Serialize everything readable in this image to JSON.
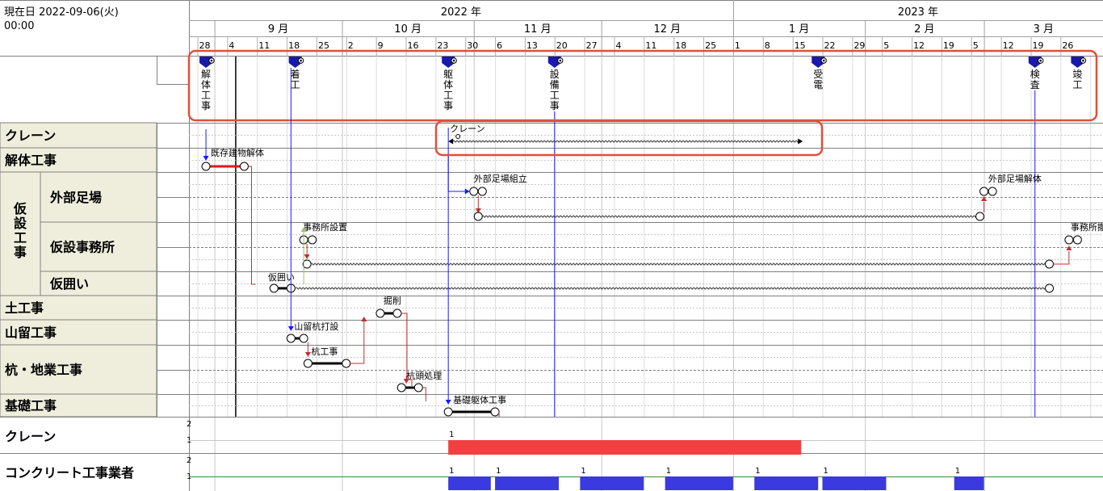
{
  "header": {
    "current_date_label": "現在日 2022-09-06(火)",
    "current_time": "00:00"
  },
  "timeline": {
    "years": [
      "2022 年",
      "2023 年"
    ],
    "months": [
      "9 月",
      "10 月",
      "11 月",
      "12 月",
      "1 月",
      "2 月",
      "3 月"
    ],
    "weeks": [
      "28",
      "4",
      "11",
      "18",
      "25",
      "2",
      "9",
      "16",
      "23",
      "30",
      "6",
      "13",
      "20",
      "27",
      "4",
      "11",
      "18",
      "25",
      "1",
      "8",
      "15",
      "22",
      "29",
      "5",
      "12",
      "19",
      "5",
      "12",
      "19",
      "26"
    ]
  },
  "milestones": [
    {
      "label": "解体工事",
      "date": "2022-08-30"
    },
    {
      "label": "着工",
      "date": "2022-09-20"
    },
    {
      "label": "躯体工事",
      "date": "2022-10-26"
    },
    {
      "label": "設備工事",
      "date": "2022-11-20"
    },
    {
      "label": "受電",
      "date": "2023-01-21"
    },
    {
      "label": "検査",
      "date": "2023-03-13"
    },
    {
      "label": "竣工",
      "date": "2023-03-23"
    }
  ],
  "categories": [
    {
      "label": "クレーン"
    },
    {
      "label": "解体工事"
    },
    {
      "label": "仮設工事",
      "children": [
        "外部足場",
        "仮設事務所",
        "仮囲い"
      ]
    },
    {
      "label": "土工事"
    },
    {
      "label": "山留工事"
    },
    {
      "label": "杭・地業工事"
    },
    {
      "label": "基礎工事"
    }
  ],
  "tasks": [
    {
      "label": "クレーン",
      "start": "2022-10-26",
      "end": "2023-01-17"
    },
    {
      "label": "既存建物解体",
      "start": "2022-08-30",
      "end": "2022-09-08"
    },
    {
      "label": "外部足場組立",
      "start": "2022-11-01",
      "end": "2022-11-03"
    },
    {
      "label": "外部足場解体",
      "start": "2023-03-01",
      "end": "2023-03-03"
    },
    {
      "label": "事務所設置",
      "start": "2022-09-22",
      "end": "2022-09-24"
    },
    {
      "label": "事務所撤去",
      "start": "2023-03-21",
      "end": "2023-03-23"
    },
    {
      "label": "仮囲い",
      "start": "2022-09-15",
      "end": "2022-09-19"
    },
    {
      "label": "掘削",
      "start": "2022-10-10",
      "end": "2022-10-14"
    },
    {
      "label": "山留杭打設",
      "start": "2022-09-19",
      "end": "2022-09-22"
    },
    {
      "label": "杭工事",
      "start": "2022-09-23",
      "end": "2022-10-02"
    },
    {
      "label": "杭頭処理",
      "start": "2022-10-15",
      "end": "2022-10-19"
    },
    {
      "label": "基礎躯体工事",
      "start": "2022-10-26",
      "end": "2022-11-06"
    }
  ],
  "resources": [
    {
      "label": "クレーン",
      "axis": [
        "2",
        "1"
      ],
      "value_labels": [
        "1"
      ],
      "color": "#f24040"
    },
    {
      "label": "コンクリート工事業者",
      "axis": [
        "2",
        "1"
      ],
      "value_labels": [
        "1",
        "1",
        "1",
        "1",
        "1",
        "1",
        "1"
      ],
      "color": "#3a3ae0"
    }
  ],
  "colors": {
    "header_fill": "#ffffff",
    "category_fill": "#efeedd",
    "highlight_border": "#e0503a",
    "bar_black": "#000000",
    "bar_red": "#e01818",
    "link_blue": "#1a1aff",
    "link_red": "#c03030"
  }
}
